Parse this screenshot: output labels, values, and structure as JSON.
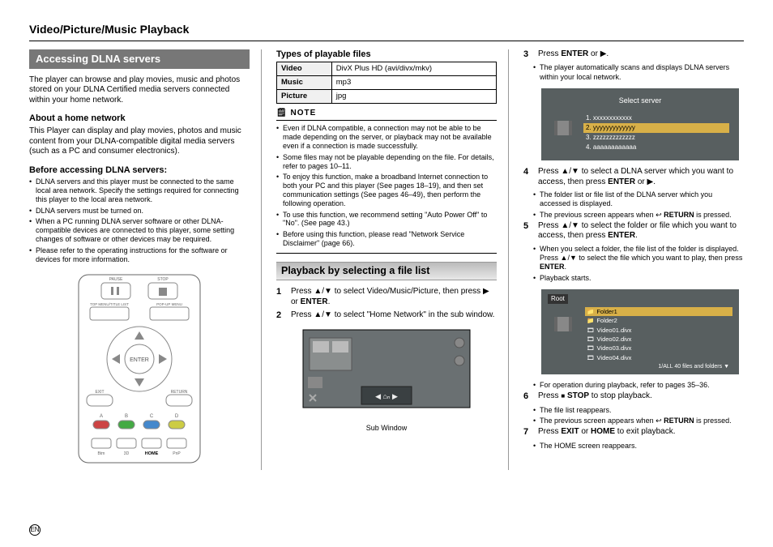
{
  "header": "Video/Picture/Music Playback",
  "col1": {
    "band": "Accessing DLNA servers",
    "intro": "The player can browse and play movies, music and photos stored on your DLNA Certified media servers connected within your home network.",
    "about_head": "About a home network",
    "about_text": "This Player can display and play movies, photos and music content from your DLNA-compatible digital media servers (such as a PC and consumer electronics).",
    "before_head": "Before accessing DLNA servers:",
    "before_items": [
      "DLNA servers and this player must be connected to the same local area network. Specify the settings required for connecting this player to the local area network.",
      "DLNA servers must be turned on.",
      "When a PC running DLNA server software or other DLNA-compatible devices are connected to this player, some setting changes of software or other devices may be required.",
      "Please refer to the operating instructions for the software or devices for more information."
    ],
    "remote_labels": {
      "pause": "PAUSE",
      "stop": "STOP",
      "top_menu": "TOP MENU/TITLE LIST",
      "popup": "POP-UP MENU",
      "enter": "ENTER",
      "exit": "EXIT",
      "return": "RETURN",
      "a": "A",
      "b": "B",
      "c": "C",
      "d": "D",
      "btm1": "Btm",
      "btm2": "3D",
      "btm3": "HOME",
      "btm4": "PnP"
    }
  },
  "col2": {
    "types_head": "Types of playable files",
    "rows": [
      {
        "k": "Video",
        "v": "DivX Plus HD (avi/divx/mkv)"
      },
      {
        "k": "Music",
        "v": "mp3"
      },
      {
        "k": "Picture",
        "v": "jpg"
      }
    ],
    "note_label": "NOTE",
    "notes": [
      "Even if DLNA compatible, a connection may not be able to be made depending on the server, or playback may not be available even if a connection is made successfully.",
      "Some files may not be playable depending on the file. For details, refer to pages 10–11.",
      "To enjoy this function, make a broadband Internet connection to both your PC and this player (See pages 18–19), and then set communication settings (See pages 46–49), then perform the following operation.",
      "To use this function, we recommend setting \"Auto Power Off\" to \"No\". (See page 43.)",
      "Before using this function, please read \"Network Service Disclaimer\" (page 66)."
    ],
    "band2": "Playback by selecting a file list",
    "step1": "Press ▲/▼ to select Video/Music/Picture, then press ▶ or ENTER.",
    "step2": "Press ▲/▼ to select \"Home Network\" in the sub window.",
    "caption": "Sub Window"
  },
  "col3": {
    "step3": "Press ENTER or ▶.",
    "step3_sub": [
      "The player automatically scans and displays DLNA servers within your local network."
    ],
    "screen1": {
      "title": "Select server",
      "items": [
        "1. xxxxxxxxxxxx",
        "2. yyyyyyyyyyyyy",
        "3. zzzzzzzzzzzzz",
        "4. aaaaaaaaaaaa"
      ]
    },
    "step4": "Press ▲/▼ to select a DLNA server which you want to access, then press ENTER or ▶.",
    "step4_sub": [
      "The folder list or file list of the DLNA server which you accessed is displayed.",
      "The previous screen appears when ↩ RETURN is pressed."
    ],
    "step5": "Press ▲/▼ to select the folder or file which you want to access, then press ENTER.",
    "step5_sub": [
      "When you select a folder, the file list of the folder is displayed. Press ▲/▼ to select the file which you want to play, then press ENTER.",
      "Playback starts."
    ],
    "screen2": {
      "root": "Root",
      "items": [
        "Folder1",
        "Folder2",
        "Video01.divx",
        "Video02.divx",
        "Video03.divx",
        "Video04.divx"
      ],
      "count": "1/ALL  40 files and folders ▼"
    },
    "after_screen2": [
      "For operation during playback, refer to pages 35–36."
    ],
    "step6": "Press ■ STOP to stop playback.",
    "step6_sub": [
      "The file list reappears.",
      "The previous screen appears when ↩ RETURN is pressed."
    ],
    "step7": "Press EXIT or HOME to exit playback.",
    "step7_sub": [
      "The HOME screen reappears."
    ]
  },
  "page_lang": "EN"
}
